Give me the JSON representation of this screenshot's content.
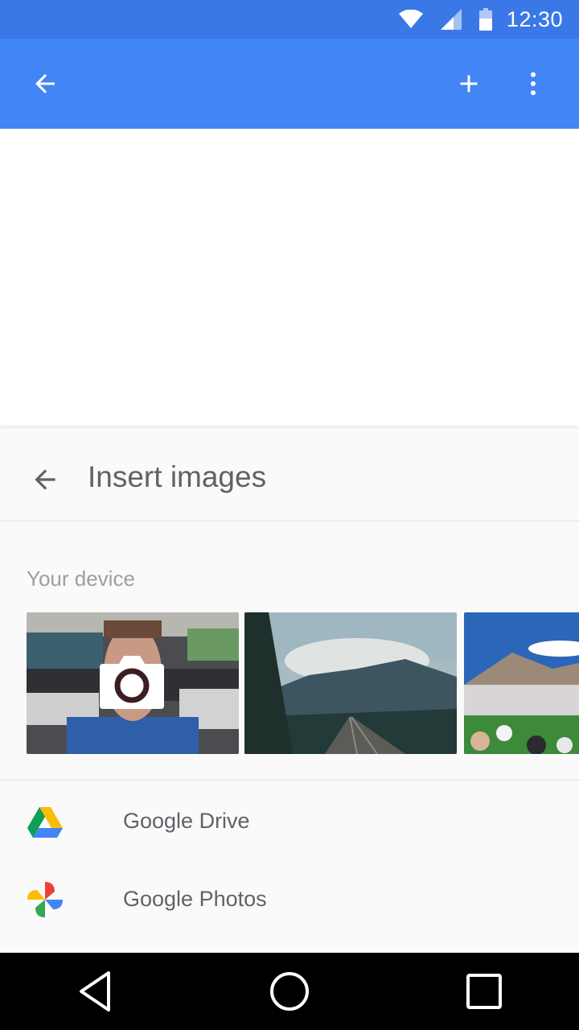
{
  "status_bar": {
    "time": "12:30",
    "icons": [
      "wifi-icon",
      "cell-signal-icon",
      "battery-icon"
    ]
  },
  "app_bar": {
    "color": "#4285f4",
    "status_color": "#3b78e7",
    "icons": [
      "back-arrow-icon",
      "plus-icon",
      "more-vert-icon"
    ]
  },
  "sheet": {
    "title": "Insert images",
    "section_label": "Your device",
    "thumbnails": [
      {
        "name": "camera-photo-office",
        "icon": "camera-icon"
      },
      {
        "name": "photo-railway-mountains"
      },
      {
        "name": "photo-stadium-crowd"
      }
    ],
    "sources": [
      {
        "label": "Google Drive",
        "icon": "google-drive-icon"
      },
      {
        "label": "Google Photos",
        "icon": "google-photos-icon"
      }
    ]
  },
  "nav_bar": {
    "icons": [
      "nav-back-icon",
      "nav-home-icon",
      "nav-recents-icon"
    ]
  }
}
